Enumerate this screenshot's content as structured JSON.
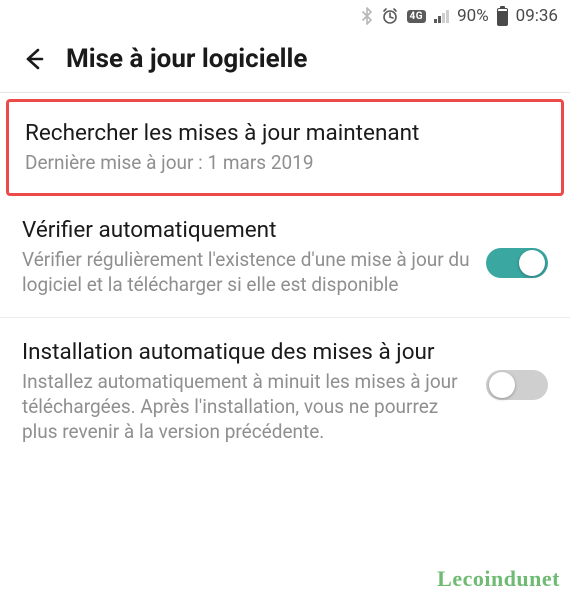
{
  "status_bar": {
    "network_badge": "4G",
    "battery_pct": "90%",
    "time": "09:36"
  },
  "header": {
    "title": "Mise à jour logicielle"
  },
  "items": {
    "check_now": {
      "title": "Rechercher les mises à jour maintenant",
      "subtitle": "Dernière mise à jour : 1 mars 2019"
    },
    "auto_check": {
      "title": "Vérifier automatiquement",
      "subtitle": "Vérifier régulièrement l'existence d'une mise à jour du logiciel et la télécharger si elle est disponible",
      "toggle": true
    },
    "auto_install": {
      "title": "Installation automatique des mises à jour",
      "subtitle": "Installez automatiquement à minuit les mises à jour téléchargées. Après l'installation, vous ne pourrez plus revenir à la version précédente.",
      "toggle": false
    }
  },
  "watermark": {
    "main": "Lecoindunet"
  },
  "colors": {
    "highlight_border": "#ed4a4a",
    "toggle_on": "#3aa7a1",
    "toggle_off": "#cfcfcf"
  }
}
